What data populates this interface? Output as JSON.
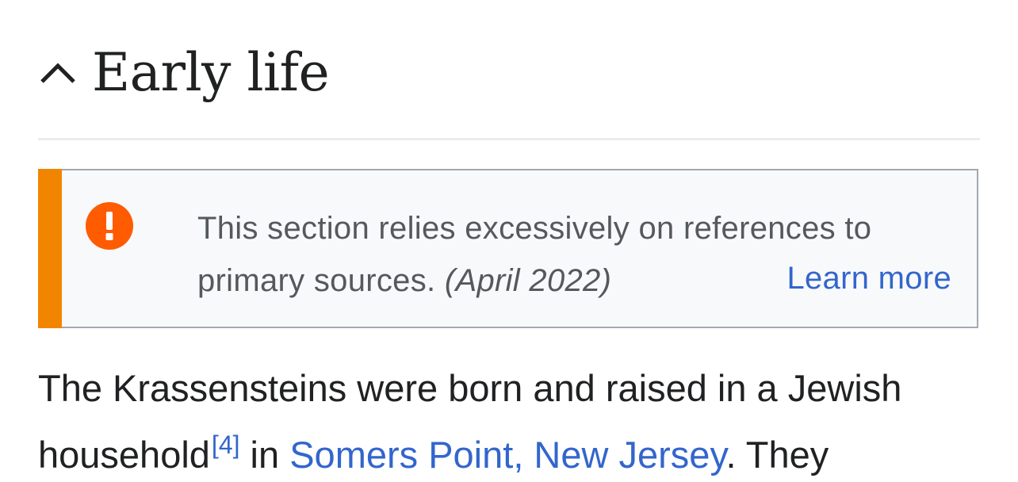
{
  "section": {
    "title": "Early life",
    "toggle_icon": "chevron-up-icon"
  },
  "notice": {
    "icon": "exclamation-icon",
    "icon_glyph": "!",
    "text": "This section relies excessively on references to primary sources.",
    "text_line1": "This section relies excessively on references to",
    "text_line2": "primary sources.",
    "date": "(April 2022)",
    "learn_more_label": "Learn more",
    "stripe_color": "#f28500",
    "icon_color": "#ff5b00"
  },
  "paragraph": {
    "line1": "The Krassensteins were born and raised in a Jewish",
    "word_household": "household",
    "ref": "[4]",
    "in": " in ",
    "link": "Somers Point, New Jersey",
    "after_link": ". They"
  },
  "colors": {
    "link": "#3366cc",
    "text": "#202122",
    "notice_text": "#54595d"
  }
}
